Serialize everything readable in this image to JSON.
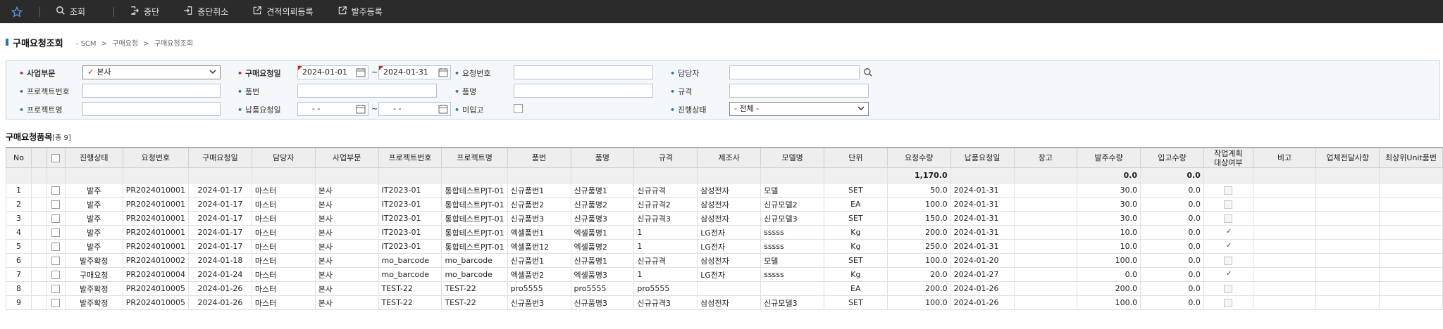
{
  "toolbar": {
    "items": [
      {
        "label": "조회",
        "icon": "search-icon"
      },
      {
        "label": "중단",
        "icon": "exit-icon"
      },
      {
        "label": "중단취소",
        "icon": "enter-icon"
      },
      {
        "label": "견적의뢰등록",
        "icon": "external-link-icon"
      },
      {
        "label": "발주등록",
        "icon": "external-link-icon"
      }
    ]
  },
  "header": {
    "title": "구매요청조회",
    "breadcrumb": [
      "SCM",
      "구매요청",
      "구매요청조회"
    ]
  },
  "search": {
    "business_label": "사업부문",
    "business_value": "본사",
    "request_date_label": "구매요청일",
    "request_date_from": "2024-01-01",
    "request_date_to": "2024-01-31",
    "request_no_label": "요청번호",
    "request_no_value": "",
    "manager_label": "담당자",
    "manager_value": "",
    "project_no_label": "프로젝트번호",
    "project_no_value": "",
    "part_no_label": "품번",
    "part_no_value": "",
    "part_name_label": "품명",
    "part_name_value": "",
    "spec_label": "규격",
    "spec_value": "",
    "project_name_label": "프로젝트명",
    "project_name_value": "",
    "delivery_date_label": "납품요청일",
    "delivery_date_from": "- -",
    "delivery_date_to": "- -",
    "not_received_label": "미입고",
    "status_label": "진행상태",
    "status_value": "- 전체 -",
    "tilde": "~"
  },
  "grid": {
    "title": "구매요청품목",
    "count_text": "[총 9]",
    "columns": [
      "No",
      "",
      "",
      "진행상태",
      "요청번호",
      "구매요청일",
      "담당자",
      "사업부문",
      "프로젝트번호",
      "프로젝트명",
      "품번",
      "품명",
      "규격",
      "제조사",
      "모델명",
      "단위",
      "요청수량",
      "납품요청일",
      "창고",
      "발주수량",
      "입고수량",
      "작업계획\n대상여부",
      "비고",
      "업체전달사항",
      "최상위Unit품번"
    ],
    "summary": {
      "request_qty": "1,170.0",
      "order_qty": "0.0",
      "received_qty": "0.0"
    },
    "rows": [
      {
        "no": "1",
        "status": "발주",
        "req_no": "PR2024010001",
        "req_date": "2024-01-17",
        "manager": "마스터",
        "biz": "본사",
        "proj_no": "IT2023-01",
        "proj_name": "통합테스트PJT-01",
        "part_no": "신규품번1",
        "part_name": "신규품명1",
        "spec": "신규규격",
        "maker": "삼성전자",
        "model": "모델",
        "unit": "SET",
        "req_qty": "50.0",
        "deliv_date": "2024-01-31",
        "warehouse": "",
        "order_qty": "30.0",
        "recv_qty": "0.0",
        "plan": false
      },
      {
        "no": "2",
        "status": "발주",
        "req_no": "PR2024010001",
        "req_date": "2024-01-17",
        "manager": "마스터",
        "biz": "본사",
        "proj_no": "IT2023-01",
        "proj_name": "통합테스트PJT-01",
        "part_no": "신규품번2",
        "part_name": "신규품명2",
        "spec": "신규규격2",
        "maker": "삼성전자",
        "model": "신규모델2",
        "unit": "EA",
        "req_qty": "100.0",
        "deliv_date": "2024-01-31",
        "warehouse": "",
        "order_qty": "30.0",
        "recv_qty": "0.0",
        "plan": false
      },
      {
        "no": "3",
        "status": "발주",
        "req_no": "PR2024010001",
        "req_date": "2024-01-17",
        "manager": "마스터",
        "biz": "본사",
        "proj_no": "IT2023-01",
        "proj_name": "통합테스트PJT-01",
        "part_no": "신규품번3",
        "part_name": "신규품명3",
        "spec": "신규규격3",
        "maker": "삼성전자",
        "model": "신규모델3",
        "unit": "SET",
        "req_qty": "150.0",
        "deliv_date": "2024-01-31",
        "warehouse": "",
        "order_qty": "30.0",
        "recv_qty": "0.0",
        "plan": false
      },
      {
        "no": "4",
        "status": "발주",
        "req_no": "PR2024010001",
        "req_date": "2024-01-17",
        "manager": "마스터",
        "biz": "본사",
        "proj_no": "IT2023-01",
        "proj_name": "통합테스트PJT-01",
        "part_no": "엑셀품번1",
        "part_name": "엑셀품명1",
        "spec": "1",
        "maker": "LG전자",
        "model": "sssss",
        "unit": "Kg",
        "req_qty": "200.0",
        "deliv_date": "2024-01-31",
        "warehouse": "",
        "order_qty": "10.0",
        "recv_qty": "0.0",
        "plan": true
      },
      {
        "no": "5",
        "status": "발주",
        "req_no": "PR2024010001",
        "req_date": "2024-01-17",
        "manager": "마스터",
        "biz": "본사",
        "proj_no": "IT2023-01",
        "proj_name": "통합테스트PJT-01",
        "part_no": "엑셀품번12",
        "part_name": "엑셀품명2",
        "spec": "1",
        "maker": "LG전자",
        "model": "sssss",
        "unit": "Kg",
        "req_qty": "250.0",
        "deliv_date": "2024-01-31",
        "warehouse": "",
        "order_qty": "10.0",
        "recv_qty": "0.0",
        "plan": true
      },
      {
        "no": "6",
        "status": "발주확정",
        "req_no": "PR2024010002",
        "req_date": "2024-01-18",
        "manager": "마스터",
        "biz": "본사",
        "proj_no": "mo_barcode",
        "proj_name": "mo_barcode",
        "part_no": "신규품번1",
        "part_name": "신규품명1",
        "spec": "신규규격",
        "maker": "삼성전자",
        "model": "모델",
        "unit": "SET",
        "req_qty": "100.0",
        "deliv_date": "2024-01-20",
        "warehouse": "",
        "order_qty": "100.0",
        "recv_qty": "0.0",
        "plan": false
      },
      {
        "no": "7",
        "status": "구매요청",
        "req_no": "PR2024010004",
        "req_date": "2024-01-24",
        "manager": "마스터",
        "biz": "본사",
        "proj_no": "mo_barcode",
        "proj_name": "mo_barcode",
        "part_no": "엑셀품번2",
        "part_name": "엑셀품명3",
        "spec": "1",
        "maker": "LG전자",
        "model": "sssss",
        "unit": "Kg",
        "req_qty": "20.0",
        "deliv_date": "2024-01-27",
        "warehouse": "",
        "order_qty": "0.0",
        "recv_qty": "0.0",
        "plan": true
      },
      {
        "no": "8",
        "status": "발주확정",
        "req_no": "PR2024010005",
        "req_date": "2024-01-26",
        "manager": "마스터",
        "biz": "본사",
        "proj_no": "TEST-22",
        "proj_name": "TEST-22",
        "part_no": "pro5555",
        "part_name": "pro5555",
        "spec": "pro5555",
        "maker": "",
        "model": "",
        "unit": "EA",
        "req_qty": "200.0",
        "deliv_date": "2024-01-26",
        "warehouse": "",
        "order_qty": "200.0",
        "recv_qty": "0.0",
        "plan": false
      },
      {
        "no": "9",
        "status": "발주확정",
        "req_no": "PR2024010005",
        "req_date": "2024-01-26",
        "manager": "마스터",
        "biz": "본사",
        "proj_no": "TEST-22",
        "proj_name": "TEST-22",
        "part_no": "신규품번3",
        "part_name": "신규품명3",
        "spec": "신규규격3",
        "maker": "삼성전자",
        "model": "신규모델3",
        "unit": "SET",
        "req_qty": "100.0",
        "deliv_date": "2024-01-26",
        "warehouse": "",
        "order_qty": "100.0",
        "recv_qty": "0.0",
        "plan": false
      }
    ]
  }
}
